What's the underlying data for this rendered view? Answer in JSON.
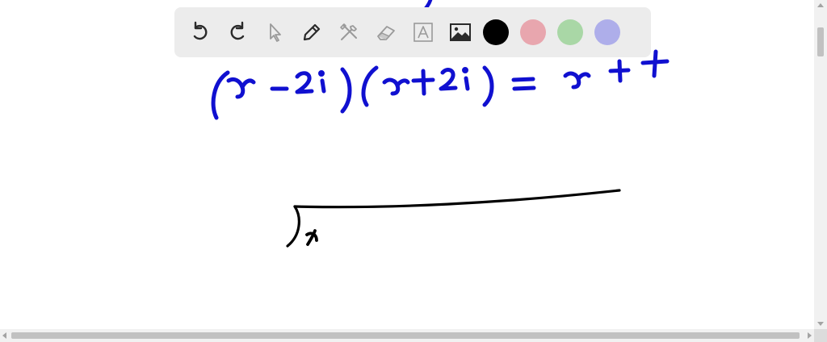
{
  "toolbar": {
    "tools": [
      {
        "name": "undo",
        "icon": "undo-icon",
        "enabled": true
      },
      {
        "name": "redo",
        "icon": "redo-icon",
        "enabled": true
      },
      {
        "name": "select",
        "icon": "cursor-icon",
        "enabled": false
      },
      {
        "name": "pen",
        "icon": "pencil-icon",
        "enabled": true
      },
      {
        "name": "tools",
        "icon": "tools-icon",
        "enabled": false
      },
      {
        "name": "eraser",
        "icon": "eraser-icon",
        "enabled": false
      },
      {
        "name": "text",
        "icon": "text-box-icon",
        "enabled": false
      },
      {
        "name": "image",
        "icon": "image-icon",
        "enabled": true
      }
    ],
    "colors": [
      {
        "name": "black",
        "hex": "#000000"
      },
      {
        "name": "red",
        "hex": "#e8a6ae"
      },
      {
        "name": "green",
        "hex": "#a9d7a6"
      },
      {
        "name": "blue",
        "hex": "#aeaeea"
      }
    ]
  },
  "ink_colors": {
    "blue": "#1010d0",
    "black": "#000000"
  }
}
